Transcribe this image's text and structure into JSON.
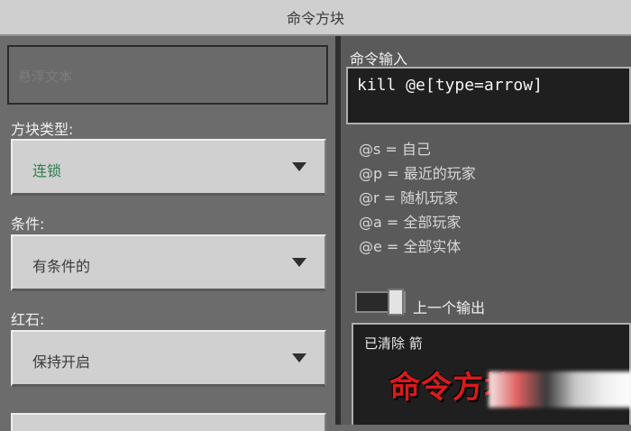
{
  "window": {
    "title": "命令方块"
  },
  "left": {
    "hover_placeholder": "悬浮文本",
    "block_type": {
      "label": "方块类型:",
      "value": "连锁",
      "value_color": "#2e7d4f"
    },
    "condition": {
      "label": "条件:",
      "value": "有条件的"
    },
    "redstone": {
      "label": "红石:",
      "value": "保持开启"
    }
  },
  "right": {
    "command_label": "命令输入",
    "command_text": "kill @e[type=arrow]",
    "selectors": [
      {
        "code": "@s",
        "desc": "自己"
      },
      {
        "code": "@p",
        "desc": "最近的玩家"
      },
      {
        "code": "@r",
        "desc": "随机玩家"
      },
      {
        "code": "@a",
        "desc": "全部玩家"
      },
      {
        "code": "@e",
        "desc": "全部实体"
      }
    ],
    "toggle_label": "上一个输出",
    "output_text": "已清除 箭",
    "watermark_text": "命令方块"
  }
}
